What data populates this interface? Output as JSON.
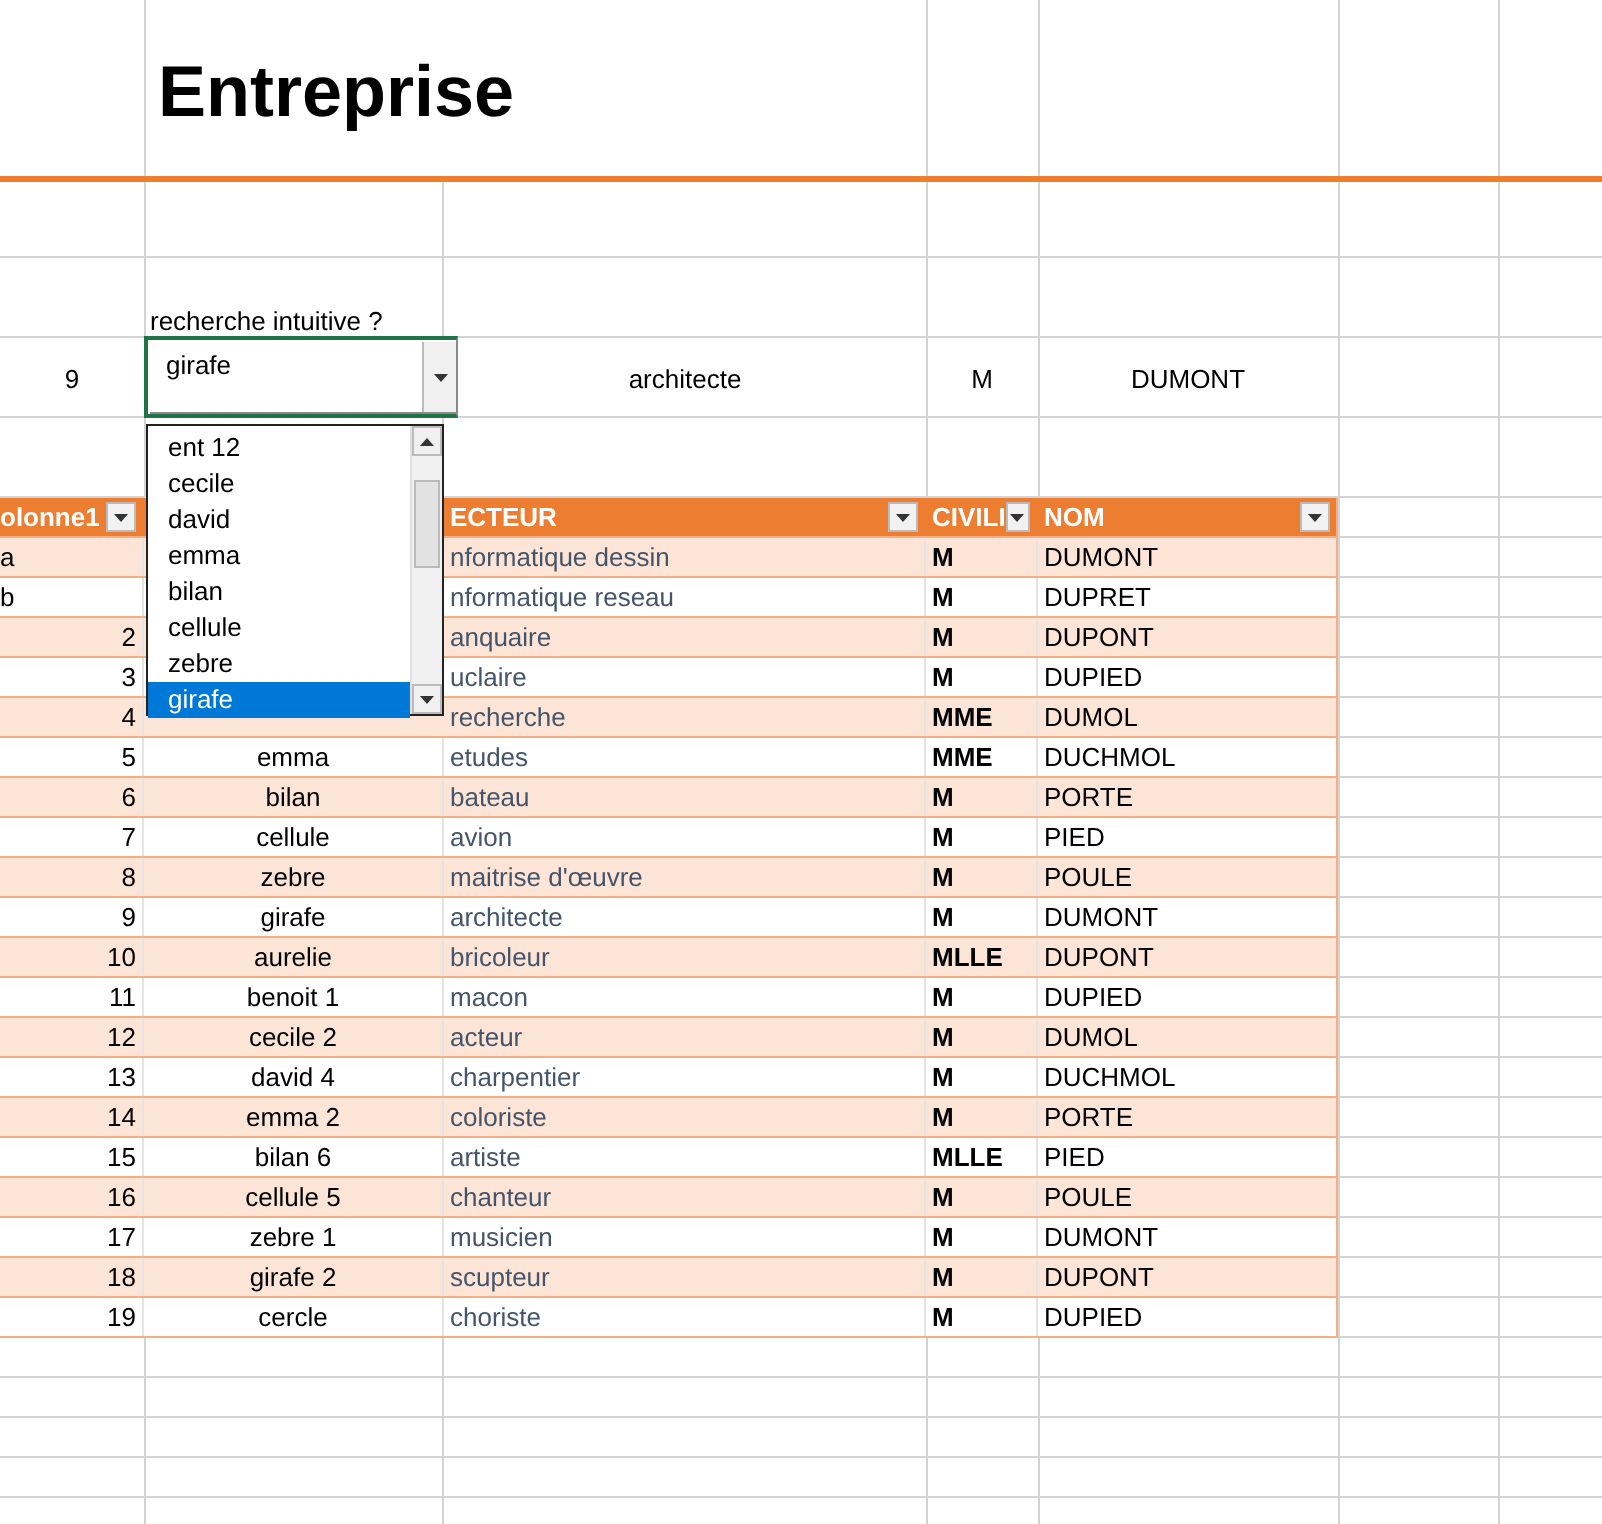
{
  "title": "Entreprise",
  "search_label": "recherche intuitive ?",
  "lookup_row": {
    "number": "9",
    "combo": {
      "value": "girafe",
      "open": true
    },
    "secteur": "architecte",
    "civilite": "M",
    "nom": "DUMONT"
  },
  "dropdown": {
    "items": [
      {
        "label": "ent 12",
        "selected": false
      },
      {
        "label": "cecile",
        "selected": false
      },
      {
        "label": "david",
        "selected": false
      },
      {
        "label": "emma",
        "selected": false
      },
      {
        "label": "bilan",
        "selected": false
      },
      {
        "label": "cellule",
        "selected": false
      },
      {
        "label": "zebre",
        "selected": false
      },
      {
        "label": "girafe",
        "selected": true
      }
    ]
  },
  "table": {
    "header": {
      "column_1": "olonne1",
      "secteur": "ECTEUR",
      "civilite": "CIVILI",
      "nom": "NOM"
    },
    "rows": [
      {
        "kind": "text",
        "column_1": "a",
        "secteur": "nformatique dessin",
        "civilite": "M",
        "nom": "DUMONT"
      },
      {
        "kind": "text",
        "column_1": "b",
        "secteur": "nformatique reseau",
        "civilite": "M",
        "nom": "DUPRET"
      },
      {
        "kind": "number",
        "column_1": "2",
        "secteur": "anquaire",
        "civilite": "M",
        "nom": "DUPONT"
      },
      {
        "kind": "number",
        "column_1": "3",
        "secteur": "uclaire",
        "civilite": "M",
        "nom": "DUPIED"
      },
      {
        "kind": "number",
        "column_1": "4",
        "secteur": "recherche",
        "civilite": "MME",
        "nom": "DUMOL"
      },
      {
        "kind": "number",
        "column_1": "5",
        "column_2": "emma",
        "secteur": "etudes",
        "civilite": "MME",
        "nom": "DUCHMOL"
      },
      {
        "kind": "number",
        "column_1": "6",
        "column_2": "bilan",
        "secteur": "bateau",
        "civilite": "M",
        "nom": "PORTE"
      },
      {
        "kind": "number",
        "column_1": "7",
        "column_2": "cellule",
        "secteur": "avion",
        "civilite": "M",
        "nom": "PIED"
      },
      {
        "kind": "number",
        "column_1": "8",
        "column_2": "zebre",
        "secteur": "maitrise d'œuvre",
        "civilite": "M",
        "nom": "POULE"
      },
      {
        "kind": "number",
        "column_1": "9",
        "column_2": "girafe",
        "secteur": "architecte",
        "civilite": "M",
        "nom": "DUMONT"
      },
      {
        "kind": "number",
        "column_1": "10",
        "column_2": "aurelie",
        "secteur": "bricoleur",
        "civilite": "MLLE",
        "nom": "DUPONT"
      },
      {
        "kind": "number",
        "column_1": "11",
        "column_2": "benoit 1",
        "secteur": "macon",
        "civilite": "M",
        "nom": "DUPIED"
      },
      {
        "kind": "number",
        "column_1": "12",
        "column_2": "cecile 2",
        "secteur": "acteur",
        "civilite": "M",
        "nom": "DUMOL"
      },
      {
        "kind": "number",
        "column_1": "13",
        "column_2": "david 4",
        "secteur": "charpentier",
        "civilite": "M",
        "nom": "DUCHMOL"
      },
      {
        "kind": "number",
        "column_1": "14",
        "column_2": "emma 2",
        "secteur": "coloriste",
        "civilite": "M",
        "nom": "PORTE"
      },
      {
        "kind": "number",
        "column_1": "15",
        "column_2": "bilan 6",
        "secteur": "artiste",
        "civilite": "MLLE",
        "nom": "PIED"
      },
      {
        "kind": "number",
        "column_1": "16",
        "column_2": "cellule 5",
        "secteur": "chanteur",
        "civilite": "M",
        "nom": "POULE"
      },
      {
        "kind": "number",
        "column_1": "17",
        "column_2": "zebre 1",
        "secteur": "musicien",
        "civilite": "M",
        "nom": "DUMONT"
      },
      {
        "kind": "number",
        "column_1": "18",
        "column_2": "girafe 2",
        "secteur": "scupteur",
        "civilite": "M",
        "nom": "DUPONT"
      },
      {
        "kind": "number",
        "column_1": "19",
        "column_2": "cercle",
        "secteur": "choriste",
        "civilite": "M",
        "nom": "DUPIED"
      }
    ]
  }
}
